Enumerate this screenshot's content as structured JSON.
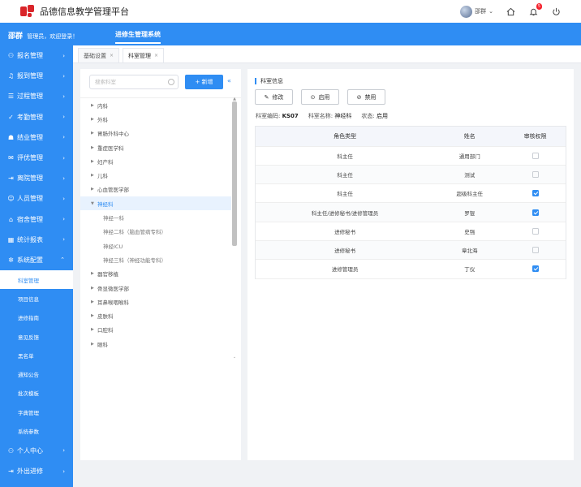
{
  "app": {
    "title": "品德信息教学管理平台"
  },
  "topbar": {
    "user_name": "邵群",
    "notification_count": "5"
  },
  "banner": {
    "user": "邵群",
    "welcome": "管理员，欢迎登录！",
    "system_tab": "进修生管理系统"
  },
  "sidebar": {
    "items": [
      {
        "label": "报名管理",
        "icon": "user-icon"
      },
      {
        "label": "报到管理",
        "icon": "bell-icon"
      },
      {
        "label": "过程管理",
        "icon": "document-icon"
      },
      {
        "label": "考勤管理",
        "icon": "check-icon"
      },
      {
        "label": "结业管理",
        "icon": "certificate-icon"
      },
      {
        "label": "评优管理",
        "icon": "comment-icon"
      },
      {
        "label": "离院管理",
        "icon": "exit-icon"
      },
      {
        "label": "人员管理",
        "icon": "person-icon"
      },
      {
        "label": "宿舍管理",
        "icon": "home-icon"
      },
      {
        "label": "统计报表",
        "icon": "chart-icon"
      },
      {
        "label": "系统配置",
        "icon": "gear-icon"
      }
    ],
    "sub_items": [
      "科室管理",
      "项目信息",
      "进修指南",
      "意见反馈",
      "黑名单",
      "通知公告",
      "批次模板",
      "字典管理",
      "系统参数"
    ],
    "bottom_items": [
      {
        "label": "个人中心",
        "icon": "user-icon"
      },
      {
        "label": "外出进修",
        "icon": "exit-icon"
      }
    ]
  },
  "tabs": [
    {
      "label": "基础设置",
      "close": "×"
    },
    {
      "label": "科室管理",
      "close": "×"
    }
  ],
  "left": {
    "search_placeholder": "搜索科室",
    "add_button": "+ 新增",
    "collapse": "«",
    "tree_before": [
      "内科",
      "外科",
      "胃肠外科中心",
      "重症医学科",
      "妇产科",
      "儿科",
      "心血管医学部"
    ],
    "open_node": "神经科",
    "open_children": [
      "神经一科",
      "神经二科（脑血管病专科）",
      "神经ICU",
      "神经三科（神经功能专科）"
    ],
    "tree_after": [
      "器官移植",
      "骨显微医学部",
      "耳鼻喉咽喉科",
      "皮肤科",
      "口腔科",
      "眼科"
    ]
  },
  "right": {
    "section_title": "科室信息",
    "buttons": {
      "edit": "修改",
      "enable": "启用",
      "disable": "禁用"
    },
    "info": {
      "code_label": "科室编码:",
      "code": "KS07",
      "name_label": "科室名称:",
      "name": "神经科",
      "status_label": "状态:",
      "status": "启用"
    },
    "table": {
      "headers": [
        "角色类型",
        "姓名",
        "审核权限"
      ],
      "rows": [
        {
          "role": "科主任",
          "name": "通用部门",
          "checked": false
        },
        {
          "role": "科主任",
          "name": "测试",
          "checked": false
        },
        {
          "role": "科主任",
          "name": "超级科主任",
          "checked": true
        },
        {
          "role": "科主任/进修秘书/进修管理员",
          "name": "罗锟",
          "checked": true
        },
        {
          "role": "进修秘书",
          "name": "史强",
          "checked": false
        },
        {
          "role": "进修秘书",
          "name": "章北海",
          "checked": false
        },
        {
          "role": "进修管理员",
          "name": "丁仪",
          "checked": true
        }
      ]
    }
  },
  "colors": {
    "primary": "#2f8df3",
    "logo": "#d9252a"
  }
}
